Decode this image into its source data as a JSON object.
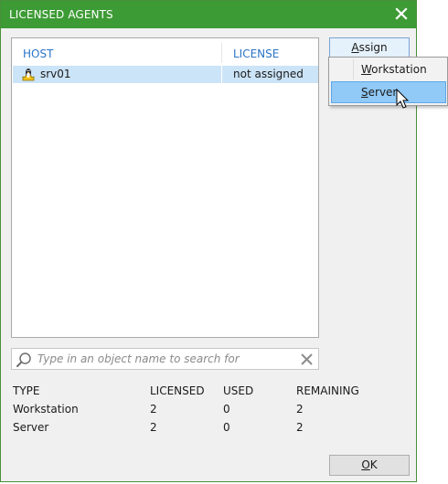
{
  "window": {
    "title": "LICENSED AGENTS"
  },
  "table": {
    "columns": {
      "host": "HOST",
      "license": "LICENSE"
    },
    "rows": [
      {
        "host": "srv01",
        "license": "not assigned",
        "icon": "linux-penguin-icon"
      }
    ]
  },
  "assign": {
    "label_prefix": "",
    "label_accel": "A",
    "label_rest": "ssign",
    "menu": [
      {
        "accel": "W",
        "rest": "orkstation"
      },
      {
        "accel": "S",
        "rest": "erver"
      }
    ],
    "highlighted": "Server"
  },
  "search": {
    "placeholder": "Type in an object name to search for",
    "value": ""
  },
  "stats": {
    "headers": {
      "type": "TYPE",
      "licensed": "LICENSED",
      "used": "USED",
      "remaining": "REMAINING"
    },
    "rows": [
      {
        "type": "Workstation",
        "licensed": "2",
        "used": "0",
        "remaining": "2"
      },
      {
        "type": "Server",
        "licensed": "2",
        "used": "0",
        "remaining": "2"
      }
    ]
  },
  "buttons": {
    "ok_accel": "O",
    "ok_rest": "K"
  },
  "colors": {
    "titlebar": "#3d9b35",
    "header_text": "#2a74c9",
    "selection": "#cce4f7",
    "menu_highlight": "#91c9f7"
  }
}
